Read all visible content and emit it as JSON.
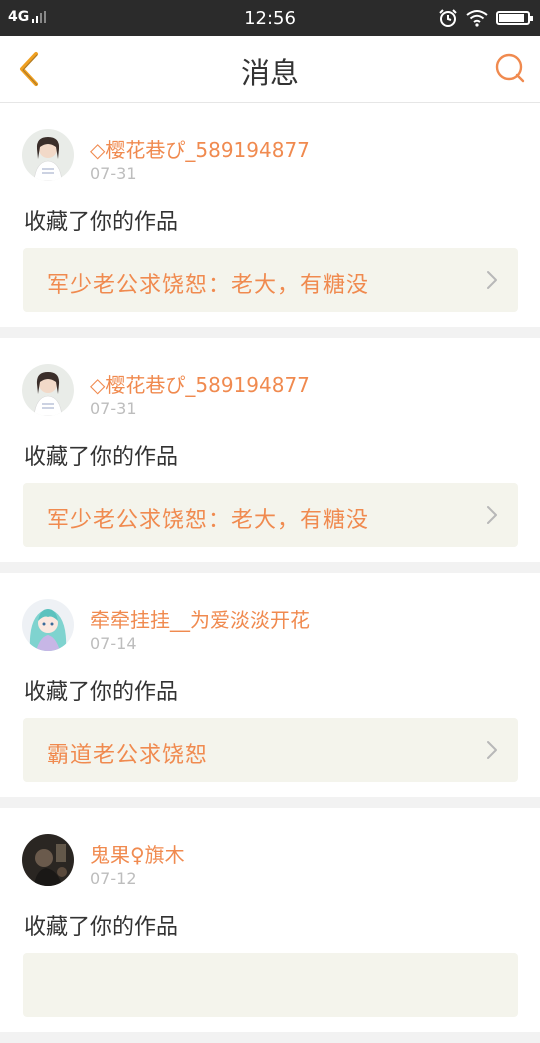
{
  "statusbar": {
    "network": "4G",
    "time": "12:56",
    "alarm_icon": "alarm-clock-icon",
    "wifi_icon": "wifi-icon",
    "battery_level": 0.9
  },
  "header": {
    "title": "消息",
    "back_icon": "chevron-left-icon",
    "search_icon": "search-icon",
    "accent_color": "#f0a020"
  },
  "colors": {
    "username": "#f08a4f",
    "work_title": "#f08a4f",
    "work_bg": "#f4f4ec",
    "date": "#bdbdbd"
  },
  "messages": [
    {
      "username": "◇樱花巷ぴ_589194877",
      "date": "07-31",
      "action": "收藏了你的作品",
      "work_title": "军少老公求饶恕：老大，有糖没",
      "avatar": "girl-avatar"
    },
    {
      "username": "◇樱花巷ぴ_589194877",
      "date": "07-31",
      "action": "收藏了你的作品",
      "work_title": "军少老公求饶恕：老大，有糖没",
      "avatar": "girl-avatar"
    },
    {
      "username": "牵牵挂挂__为爱淡淡开花",
      "date": "07-14",
      "action": "收藏了你的作品",
      "work_title": "霸道老公求饶恕",
      "avatar": "anime-girl-avatar"
    },
    {
      "username": "鬼果♀旗木",
      "date": "07-12",
      "action": "收藏了你的作品",
      "work_title": "",
      "avatar": "dark-photo-avatar"
    }
  ]
}
